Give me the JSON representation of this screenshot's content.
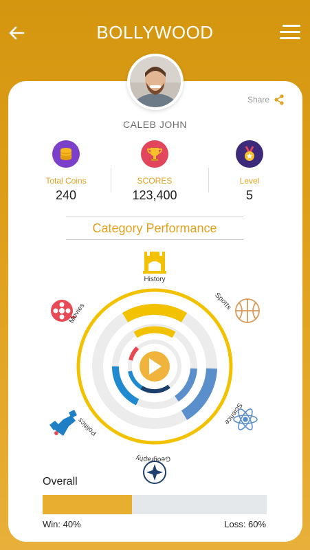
{
  "header": {
    "title": "BOLLYWOOD",
    "back_icon": "arrow-left-icon",
    "menu_icon": "hamburger-menu-icon"
  },
  "profile": {
    "name": "CALEB JOHN",
    "share_label": "Share"
  },
  "stats": [
    {
      "label": "Total Coins",
      "value": "240",
      "icon": "coins-icon",
      "color": "#7b3fc9"
    },
    {
      "label": "SCORES",
      "value": "123,400",
      "icon": "trophy-icon",
      "color": "#e2465c"
    },
    {
      "label": "Level",
      "value": "5",
      "icon": "medal-icon",
      "color": "#3e2a7a"
    }
  ],
  "category_section": {
    "title": "Category Performance",
    "categories": [
      {
        "name": "History",
        "icon": "castle-icon",
        "color": "#f2c200"
      },
      {
        "name": "Sports",
        "icon": "basketball-icon",
        "color": "#d99a5a"
      },
      {
        "name": "Science",
        "icon": "atom-icon",
        "color": "#5b8fcc"
      },
      {
        "name": "Geography",
        "icon": "compass-icon",
        "color": "#1d3f6b"
      },
      {
        "name": "Politics",
        "icon": "handshake-icon",
        "color": "#1f7fc4"
      },
      {
        "name": "Movies",
        "icon": "film-reel-icon",
        "color": "#e84a55"
      }
    ]
  },
  "overall": {
    "label": "Overall",
    "win_fraction": 0.4,
    "win_text": "Win: 40%",
    "loss_text": "Loss: 60%"
  },
  "colors": {
    "accent": "#e0a21e",
    "background": "#d9991a",
    "progress_fill": "#e8ae2f",
    "progress_track": "#e4e8eb"
  }
}
